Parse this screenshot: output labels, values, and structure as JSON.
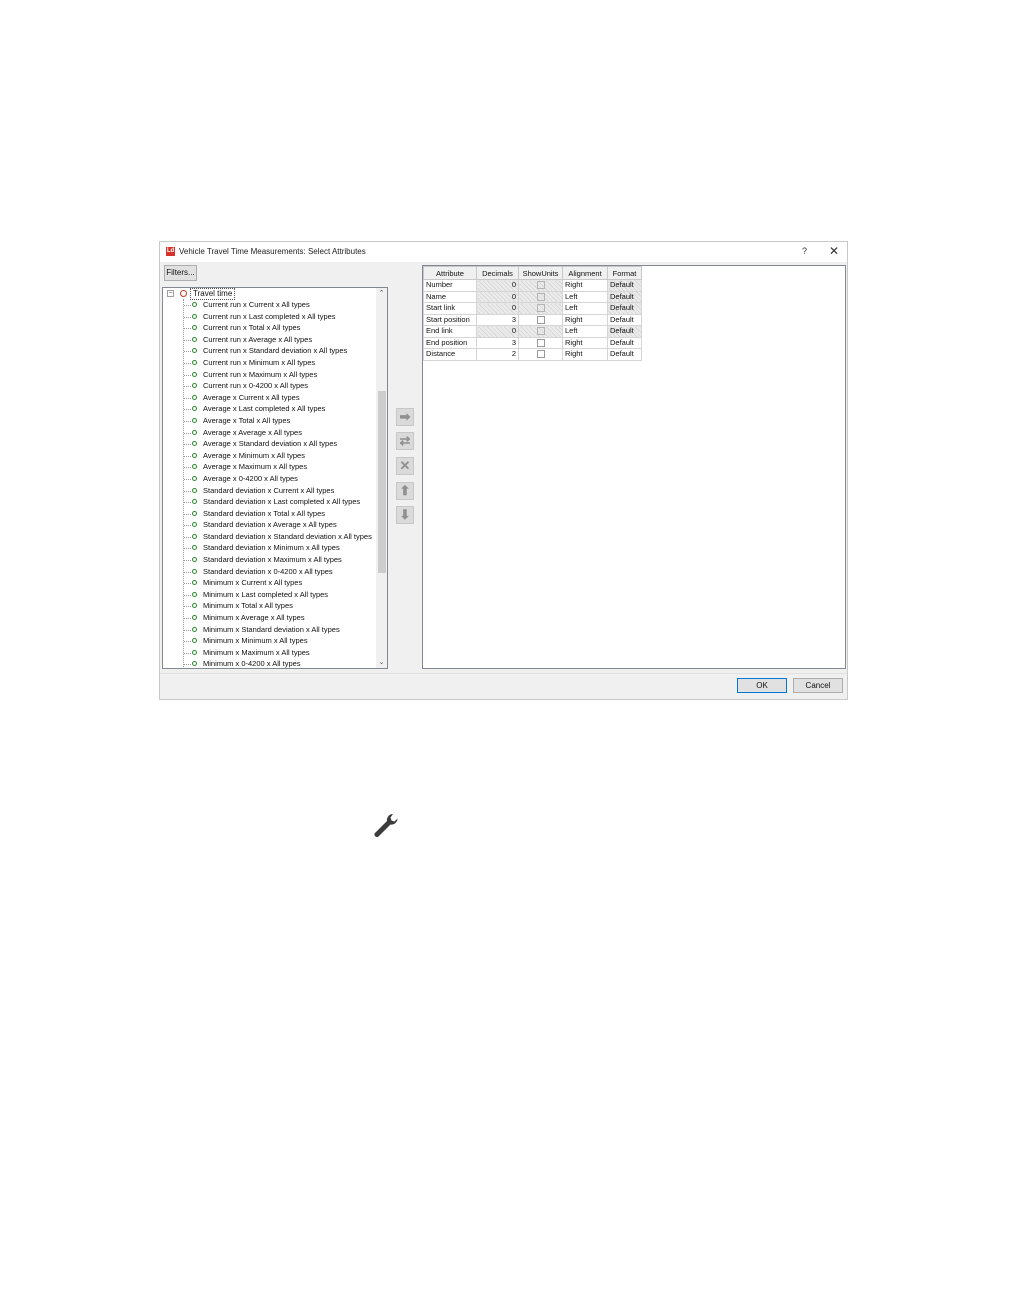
{
  "dialog": {
    "title": "Vehicle Travel Time Measurements: Select Attributes",
    "help_label": "?",
    "close_label": "✕",
    "app_icon_text": "Ld"
  },
  "filters_label": "Filters...",
  "tree": {
    "root_label": "Travel time",
    "items": [
      "Current run x Current x All types",
      "Current run x Last completed x All types",
      "Current run x Total x All types",
      "Current run x Average x All types",
      "Current run x Standard deviation x All types",
      "Current run x Minimum x All types",
      "Current run x Maximum x All types",
      "Current run x 0-4200 x All types",
      "Average x Current x All types",
      "Average x Last completed x All types",
      "Average x Total x All types",
      "Average x Average x All types",
      "Average x Standard deviation x All types",
      "Average x Minimum x All types",
      "Average x Maximum x All types",
      "Average x 0-4200 x All types",
      "Standard deviation x Current x All types",
      "Standard deviation x Last completed x All types",
      "Standard deviation x Total x All types",
      "Standard deviation x Average x All types",
      "Standard deviation x Standard deviation x All types",
      "Standard deviation x Minimum x All types",
      "Standard deviation x Maximum x All types",
      "Standard deviation x 0-4200 x All types",
      "Minimum x Current x All types",
      "Minimum x Last completed x All types",
      "Minimum x Total x All types",
      "Minimum x Average x All types",
      "Minimum x Standard deviation x All types",
      "Minimum x Minimum x All types",
      "Minimum x Maximum x All types",
      "Minimum x 0-4200 x All types"
    ],
    "scroll_up": "⌃",
    "scroll_down": "⌄"
  },
  "side_buttons": [
    {
      "name": "add-arrow-icon",
      "glyph": "➡"
    },
    {
      "name": "add-with-options-icon",
      "glyph": "⇄"
    },
    {
      "name": "remove-x-icon",
      "glyph": "✕"
    },
    {
      "name": "move-up-icon",
      "glyph": "⬆"
    },
    {
      "name": "move-down-icon",
      "glyph": "⬇"
    }
  ],
  "grid": {
    "headers": [
      "Attribute",
      "Decimals",
      "ShowUnits",
      "Alignment",
      "Format"
    ],
    "rows": [
      {
        "attribute": "Number",
        "decimals": "0",
        "locked": true,
        "alignment": "Right",
        "format": "Default"
      },
      {
        "attribute": "Name",
        "decimals": "0",
        "locked": true,
        "alignment": "Left",
        "format": "Default"
      },
      {
        "attribute": "Start link",
        "decimals": "0",
        "locked": true,
        "alignment": "Left",
        "format": "Default"
      },
      {
        "attribute": "Start position",
        "decimals": "3",
        "locked": false,
        "alignment": "Right",
        "format": "Default"
      },
      {
        "attribute": "End link",
        "decimals": "0",
        "locked": true,
        "alignment": "Left",
        "format": "Default"
      },
      {
        "attribute": "End position",
        "decimals": "3",
        "locked": false,
        "alignment": "Right",
        "format": "Default"
      },
      {
        "attribute": "Distance",
        "decimals": "2",
        "locked": false,
        "alignment": "Right",
        "format": "Default"
      }
    ]
  },
  "buttons": {
    "ok": "OK",
    "cancel": "Cancel"
  },
  "colors": {
    "accent": "#0078d7",
    "app_icon": "#d6312b",
    "tree_dot": "#2a8a2a",
    "root_dot": "#c0392b"
  }
}
